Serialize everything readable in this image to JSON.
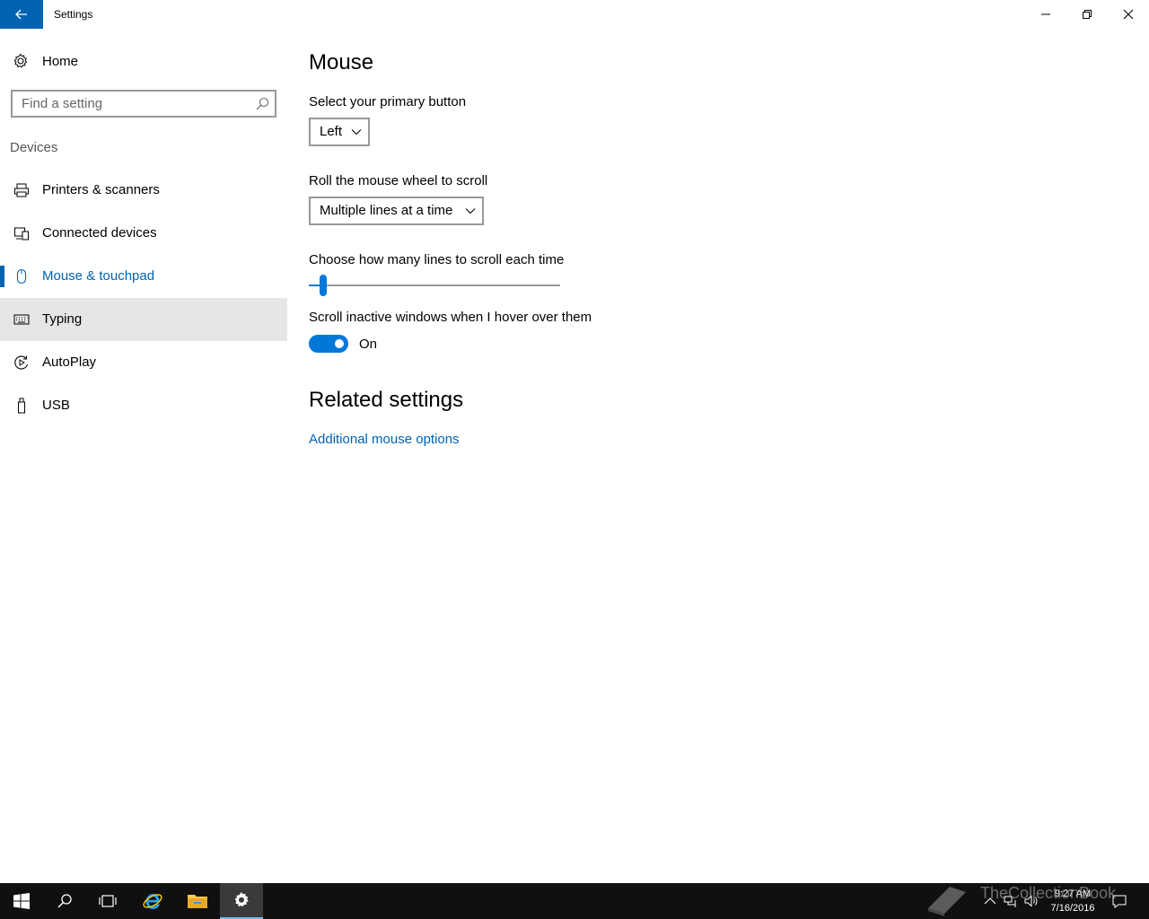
{
  "window": {
    "title": "Settings",
    "accent": "#0063b1"
  },
  "sidebar": {
    "home_label": "Home",
    "search_placeholder": "Find a setting",
    "section_label": "Devices",
    "items": [
      {
        "label": "Printers & scanners",
        "icon": "printer-icon"
      },
      {
        "label": "Connected devices",
        "icon": "connected-devices-icon"
      },
      {
        "label": "Mouse & touchpad",
        "icon": "mouse-icon",
        "selected": true
      },
      {
        "label": "Typing",
        "icon": "keyboard-icon",
        "hovered": true
      },
      {
        "label": "AutoPlay",
        "icon": "autoplay-icon"
      },
      {
        "label": "USB",
        "icon": "usb-icon"
      }
    ]
  },
  "main": {
    "title": "Mouse",
    "primary_button_label": "Select your primary button",
    "primary_button_value": "Left",
    "wheel_label": "Roll the mouse wheel to scroll",
    "wheel_value": "Multiple lines at a time",
    "lines_label": "Choose how many lines to scroll each time",
    "lines_slider_fraction": 0.03,
    "inactive_label": "Scroll inactive windows when I hover over them",
    "inactive_state": "On",
    "related_title": "Related settings",
    "related_link": "Additional mouse options"
  },
  "taskbar": {
    "time": "9:27 AM",
    "date": "7/16/2016",
    "watermark": "TheCollectionBook"
  }
}
